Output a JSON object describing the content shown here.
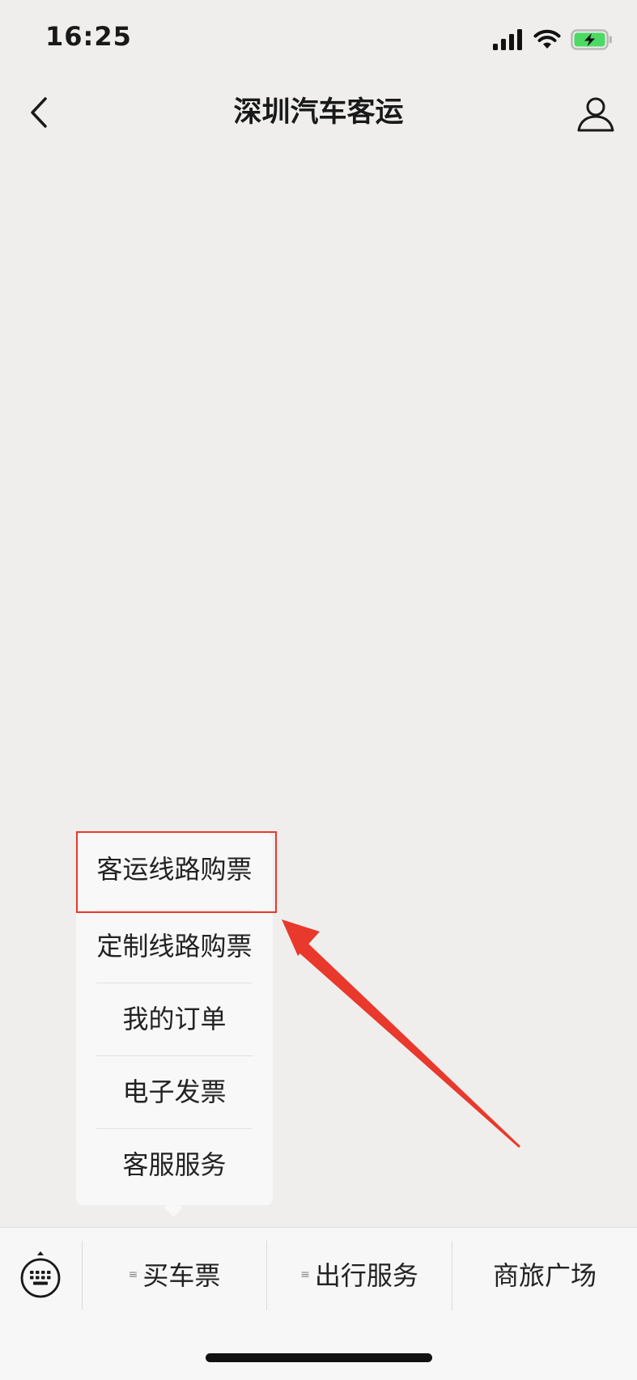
{
  "status_bar": {
    "time": "16:25",
    "signal_icon": "cellular-signal-icon",
    "wifi_icon": "wifi-icon",
    "battery_icon": "battery-charging-icon"
  },
  "nav": {
    "title": "深圳汽车客运",
    "back_icon": "chevron-left-icon",
    "profile_icon": "person-icon"
  },
  "submenu": {
    "items": [
      {
        "label": "客运线路购票",
        "highlighted": true
      },
      {
        "label": "定制线路购票"
      },
      {
        "label": "我的订单"
      },
      {
        "label": "电子发票"
      },
      {
        "label": "客服服务"
      }
    ]
  },
  "bottom_menu": {
    "keyboard_icon": "keyboard-icon",
    "tabs": [
      {
        "label": "买车票",
        "has_submenu": true
      },
      {
        "label": "出行服务",
        "has_submenu": true
      },
      {
        "label": "商旅广场",
        "has_submenu": false
      }
    ],
    "submenu_indicator": "≡"
  },
  "colors": {
    "background": "#efeeed",
    "annotation": "#e8392c",
    "battery_green": "#4cd964"
  }
}
